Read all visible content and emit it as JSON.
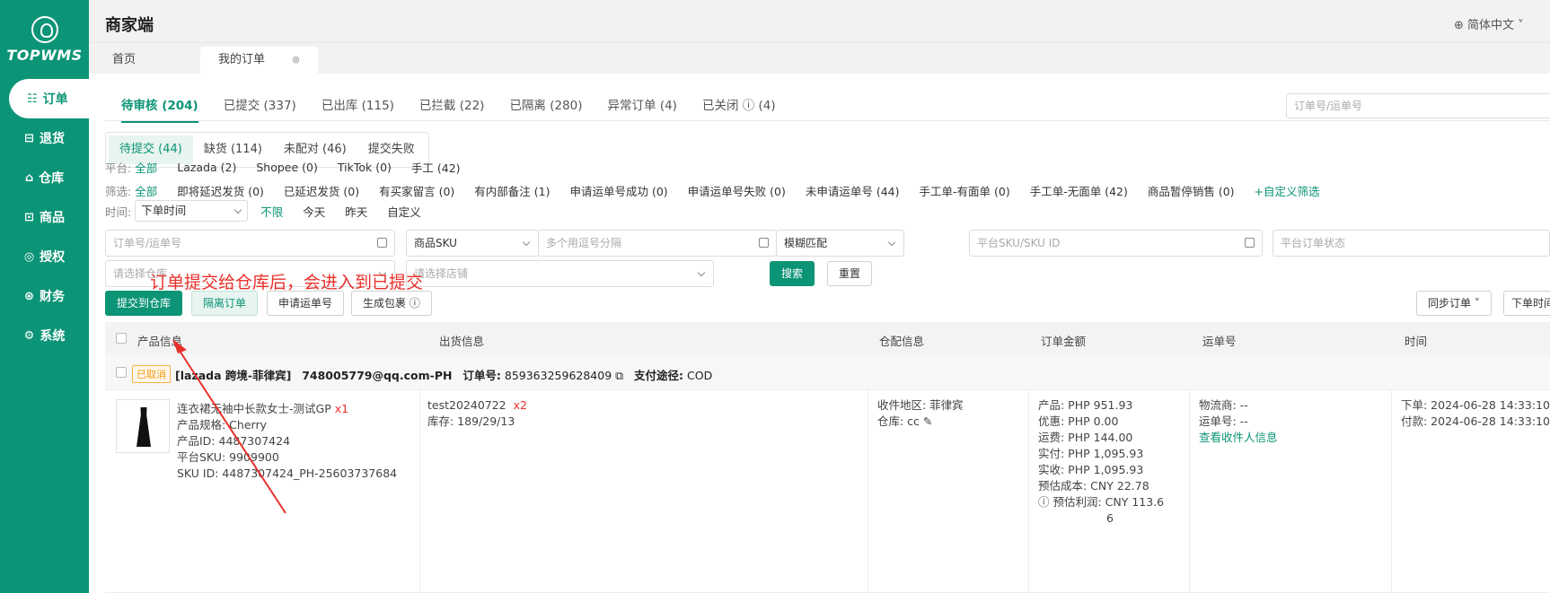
{
  "sidebar": {
    "logo": "TOPWMS",
    "items": [
      {
        "label": "订单",
        "icon": "order-icon",
        "glyph": "☷"
      },
      {
        "label": "退货",
        "icon": "return-icon",
        "glyph": "⊟"
      },
      {
        "label": "仓库",
        "icon": "warehouse-icon",
        "glyph": "⌂"
      },
      {
        "label": "商品",
        "icon": "product-icon",
        "glyph": "⊡"
      },
      {
        "label": "授权",
        "icon": "auth-icon",
        "glyph": "◎"
      },
      {
        "label": "财务",
        "icon": "finance-icon",
        "glyph": "⊛"
      },
      {
        "label": "系统",
        "icon": "settings-icon",
        "glyph": "⚙"
      }
    ]
  },
  "header": {
    "title": "商家端",
    "language": "简体中文"
  },
  "page_tabs": [
    {
      "label": "首页"
    },
    {
      "label": "我的订单"
    }
  ],
  "main_tabs": [
    "待审核 (204)",
    "已提交 (337)",
    "已出库 (115)",
    "已拦截 (22)",
    "已隔离 (280)",
    "异常订单 (4)",
    "已关闭 ⓘ (4)"
  ],
  "search_order": {
    "placeholder": "订单号/运单号"
  },
  "sub_tabs": [
    "待提交 (44)",
    "缺货 (114)",
    "未配对 (46)",
    "提交失败"
  ],
  "filters": {
    "platform_label": "平台:",
    "platforms": [
      "全部",
      "Lazada (2)",
      "Shopee (0)",
      "TikTok (0)",
      "手工 (42)"
    ],
    "screen_label": "筛选:",
    "screens": [
      "全部",
      "即将延迟发货 (0)",
      "已延迟发货 (0)",
      "有买家留言 (0)",
      "有内部备注 (1)",
      "申请运单号成功 (0)",
      "申请运单号失败 (0)",
      "未申请运单号 (44)",
      "手工单-有面单 (0)",
      "手工单-无面单 (42)",
      "商品暂停销售 (0)"
    ],
    "custom_filter": "+自定义筛选",
    "time_label": "时间:",
    "time_select": "下单时间",
    "times": [
      "不限",
      "今天",
      "昨天",
      "自定义"
    ]
  },
  "search_row1": {
    "order_placeholder": "订单号/运单号",
    "sku_type": "商品SKU",
    "multi_placeholder": "多个用逗号分隔",
    "match": "模糊匹配",
    "platform_sku_placeholder": "平台SKU/SKU ID",
    "platform_status_placeholder": "平台订单状态"
  },
  "search_row2": {
    "warehouse_placeholder": "请选择仓库",
    "shop_placeholder": "请选择店铺",
    "search_btn": "搜索",
    "reset_btn": "重置"
  },
  "actions": {
    "submit": "提交到仓库",
    "isolate": "隔离订单",
    "apply_waybill": "申请运单号",
    "gen_package": "生成包裹 ⓘ",
    "sync": "同步订单",
    "order_time": "下单时间"
  },
  "annotation": "订单提交给仓库后，会进入到已提交",
  "table": {
    "headers": [
      "产品信息",
      "出货信息",
      "仓配信息",
      "订单金额",
      "运单号",
      "时间"
    ],
    "group": {
      "status": "已取消",
      "shop": "[lazada 跨境-菲律宾]",
      "email": "748005779@qq.com-PH",
      "order_label": "订单号:",
      "order_no": "859363259628409",
      "pay_label": "支付途径:",
      "pay_method": "COD"
    },
    "row": {
      "product_name": "连衣裙无袖中长款女士-测试GP",
      "qty": "x1",
      "spec": "产品规格:  Cherry",
      "product_id": "产品ID:  4487307424",
      "platform_sku": "平台SKU:  9909900",
      "sku_id": "SKU ID:  4487307424_PH-25603737684",
      "ship_code": "test20240722",
      "ship_qty": "x2",
      "stock": "库存:  189/29/13",
      "region": "收件地区:  菲律宾",
      "warehouse": "仓库:  cc ✎",
      "amounts": [
        "产品:  PHP 951.93",
        "优惠:  PHP 0.00",
        "运费:  PHP 144.00",
        "实付:  PHP 1,095.93",
        "实收:  PHP 1,095.93",
        "预估成本:   CNY 22.78"
      ],
      "profit_line1": "ⓘ 预估利润:    CNY 113.6",
      "profit_line2": "6",
      "carrier": "物流商:  --",
      "waybill": "运单号:  --",
      "view_receiver": "查看收件人信息",
      "ordered": "下单:  2024-06-28 14:33:10",
      "paid": "付款:  2024-06-28 14:33:10"
    }
  }
}
